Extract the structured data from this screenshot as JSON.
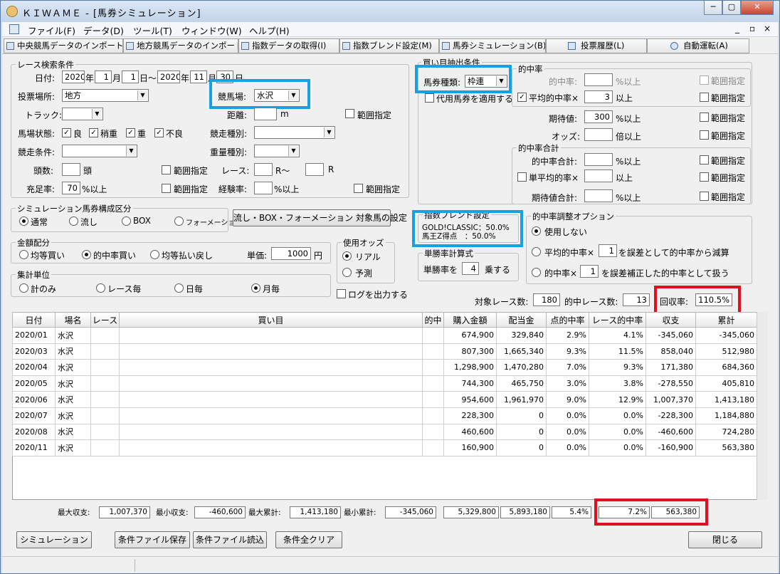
{
  "window": {
    "title": "ＫＩＷＡＭＥ - [馬券シミュレーション]",
    "min": "─",
    "max": "▢",
    "close": "✕"
  },
  "menu": [
    "ファイル(F)",
    "データ(D)",
    "ツール(T)",
    "ウィンドウ(W)",
    "ヘルプ(H)"
  ],
  "mdi": {
    "min": "_",
    "restore": "▫",
    "close": "×"
  },
  "toolbar": [
    "中央競馬データのインポート(J)",
    "地方競馬データのインポート(N)",
    "指数データの取得(I)",
    "指数ブレンド設定(M)",
    "馬券シミュレーション(B)",
    "投票履歴(L)",
    "自動運転(A)"
  ],
  "race": {
    "group": "レース検索条件",
    "date_label": "日付:",
    "from_year": "2020",
    "year_u": "年",
    "from_month": "1",
    "month_u": "月",
    "from_day": "1",
    "to_sep": "日～",
    "to_year": "2020",
    "to_month": "11",
    "to_day": "30",
    "day_u": "日",
    "venue_label": "投票場所:",
    "venue": "地方",
    "course_label": "競馬場:",
    "course": "水沢",
    "track_label": "トラック:",
    "track": "",
    "distance_label": "距離:",
    "distance": "",
    "m": "m",
    "range": "範囲指定",
    "cond_label": "馬場状態:",
    "cond": [
      "良",
      "稍重",
      "重",
      "不良"
    ],
    "race_type_label": "競走種別:",
    "race_type": "",
    "race_cond_label": "競走条件:",
    "race_cond": "",
    "weight_label": "重量種別:",
    "weight": "",
    "heads_label": "頭数:",
    "heads": "",
    "heads_u": "頭",
    "race_label": "レース:",
    "race_from": "",
    "race_sep": "R～",
    "race_to": "",
    "race_u": "R",
    "fill_label": "充足率:",
    "fill": "70",
    "fill_u": "%以上",
    "exp_label": "経験率:",
    "exp": "",
    "exp_u": "%以上"
  },
  "sim": {
    "group": "シミュレーション馬券構成区分",
    "opts": [
      "通常",
      "流し",
      "BOX",
      "フォーメーション"
    ],
    "setbtn": "流し・BOX・フォーメーション 対象馬の設定"
  },
  "money": {
    "group": "金額配分",
    "opts": [
      "均等買い",
      "的中率買い",
      "均等払い戻し"
    ],
    "unit_label": "単価:",
    "unit": "1000",
    "unit_u": "円"
  },
  "odds": {
    "group": "使用オッズ",
    "opts": [
      "リアル",
      "予測"
    ]
  },
  "agg": {
    "group": "集計単位",
    "opts": [
      "計のみ",
      "レース毎",
      "日毎",
      "月毎"
    ]
  },
  "log": "ログを出力する",
  "buy": {
    "group": "買い目抽出条件",
    "type_label": "馬券種類:",
    "type": "枠連",
    "proxy": "代用馬券を適用する",
    "hit": {
      "group": "的中率",
      "rate_label": "的中率:",
      "rate": "",
      "rate_u": "%以上",
      "avg_label": "平均的中率×",
      "avg": "3",
      "avg_u": "以上"
    },
    "exp_label": "期待値:",
    "exp": "300",
    "exp_u": "%以上",
    "odds_label": "オッズ:",
    "odds": "",
    "odds_u": "倍以上",
    "sum": {
      "group": "的中率合計",
      "total_label": "的中率合計:",
      "total": "",
      "total_u": "%以上",
      "single_label": "単平均的率×",
      "single": "",
      "single_u": "以上",
      "expsum_label": "期待値合計:",
      "expsum": "",
      "expsum_u": "%以上"
    },
    "range": "範囲指定"
  },
  "blend": {
    "group": "指数ブレンド設定",
    "line1": "GOLD!CLASSIC：50.0%",
    "line2": "馬王Z得点　：50.0%"
  },
  "adj": {
    "group": "的中率調整オプション",
    "none": "使用しない",
    "o1a": "平均的中率×",
    "o1v": "1",
    "o1b": "を誤差として的中率から減算",
    "o2a": "的中率×",
    "o2v": "1",
    "o2b": "を誤差補正した的中率として扱う"
  },
  "win": {
    "group": "単勝率計算式",
    "a": "単勝率を",
    "v": "4",
    "b": "乗する"
  },
  "stats": {
    "races_label": "対象レース数:",
    "races": "180",
    "hits_label": "的中レース数:",
    "hits": "13",
    "ret_label": "回収率:",
    "ret": "110.5%"
  },
  "table": {
    "headers": [
      "日付",
      "場名",
      "レース",
      "買い目",
      "的中",
      "購入金額",
      "配当金",
      "点的中率",
      "レース的中率",
      "収支",
      "累計"
    ],
    "rows": [
      [
        "2020/01",
        "水沢",
        "",
        "",
        "",
        "674,900",
        "329,840",
        "2.9%",
        "4.1%",
        "-345,060",
        "-345,060"
      ],
      [
        "2020/03",
        "水沢",
        "",
        "",
        "",
        "807,300",
        "1,665,340",
        "9.3%",
        "11.5%",
        "858,040",
        "512,980"
      ],
      [
        "2020/04",
        "水沢",
        "",
        "",
        "",
        "1,298,900",
        "1,470,280",
        "7.0%",
        "9.3%",
        "171,380",
        "684,360"
      ],
      [
        "2020/05",
        "水沢",
        "",
        "",
        "",
        "744,300",
        "465,750",
        "3.0%",
        "3.8%",
        "-278,550",
        "405,810"
      ],
      [
        "2020/06",
        "水沢",
        "",
        "",
        "",
        "954,600",
        "1,961,970",
        "9.0%",
        "12.9%",
        "1,007,370",
        "1,413,180"
      ],
      [
        "2020/07",
        "水沢",
        "",
        "",
        "",
        "228,300",
        "0",
        "0.0%",
        "0.0%",
        "-228,300",
        "1,184,880"
      ],
      [
        "2020/08",
        "水沢",
        "",
        "",
        "",
        "460,600",
        "0",
        "0.0%",
        "0.0%",
        "-460,600",
        "724,280"
      ],
      [
        "2020/11",
        "水沢",
        "",
        "",
        "",
        "160,900",
        "0",
        "0.0%",
        "0.0%",
        "-160,900",
        "563,380"
      ]
    ]
  },
  "summary": {
    "max_label": "最大収支:",
    "max": "1,007,370",
    "min_label": "最小収支:",
    "min": "-460,600",
    "maxc_label": "最大累計:",
    "maxc": "1,413,180",
    "minc_label": "最小累計:",
    "minc": "-345,060",
    "buy": "5,329,800",
    "pay": "5,893,180",
    "pt": "5.4%",
    "race": "7.2%",
    "total": "563,380"
  },
  "buttons": {
    "sim": "シミュレーション",
    "save": "条件ファイル保存",
    "load": "条件ファイル読込",
    "clear": "条件全クリア",
    "close": "閉じる"
  }
}
